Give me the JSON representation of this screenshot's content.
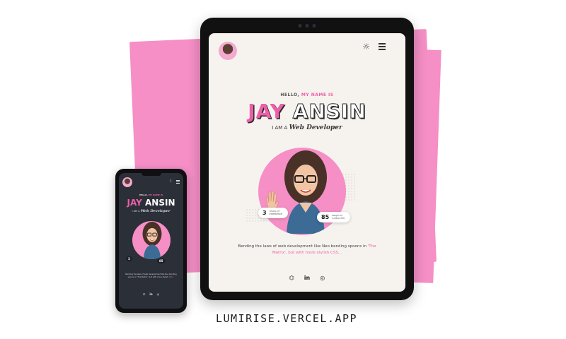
{
  "colors": {
    "accent": "#ec5fa8",
    "backdrop": "#f58fc6",
    "light_bg": "#f6f3ef",
    "dark_bg": "#2b2f38"
  },
  "icons": [
    "sun-icon",
    "menu-icon",
    "moon-icon",
    "github-icon",
    "linkedin-icon",
    "discord-icon"
  ],
  "tablet": {
    "hello_prefix": "HELLO,",
    "hello_highlight": "MY NAME IS",
    "name_first": "JAY",
    "name_last": "ANSIN",
    "role_prefix": "I AM A",
    "role": "Web Developer",
    "stats": [
      {
        "value": "3",
        "label": "YEARS OF EXPERIENCE"
      },
      {
        "value": "85",
        "label": "PROJECTS COMPLETED"
      }
    ],
    "bio": "Bending the laws of web development like Neo bending spoons in",
    "bio_highlight": "'The Matrix', but with more stylish CSS...",
    "social": {
      "github": "⌬",
      "linkedin": "in",
      "discord": "◎"
    }
  },
  "phone": {
    "hello_prefix": "HELLO,",
    "hello_highlight": "MY NAME IS",
    "name_first": "JAY",
    "name_last": "ANSIN",
    "role_prefix": "I AM A",
    "role": "Web Developer",
    "stats": [
      {
        "value": "3"
      },
      {
        "value": "85"
      }
    ],
    "bio": "Bending the laws of web development like Neo bending spoons in 'The Matrix', but with more stylish",
    "bio_highlight": "CSS...",
    "social": {
      "github": "⌬",
      "linkedin": "in",
      "discord": "◎"
    }
  },
  "caption": "LUMIRISE.VERCEL.APP"
}
